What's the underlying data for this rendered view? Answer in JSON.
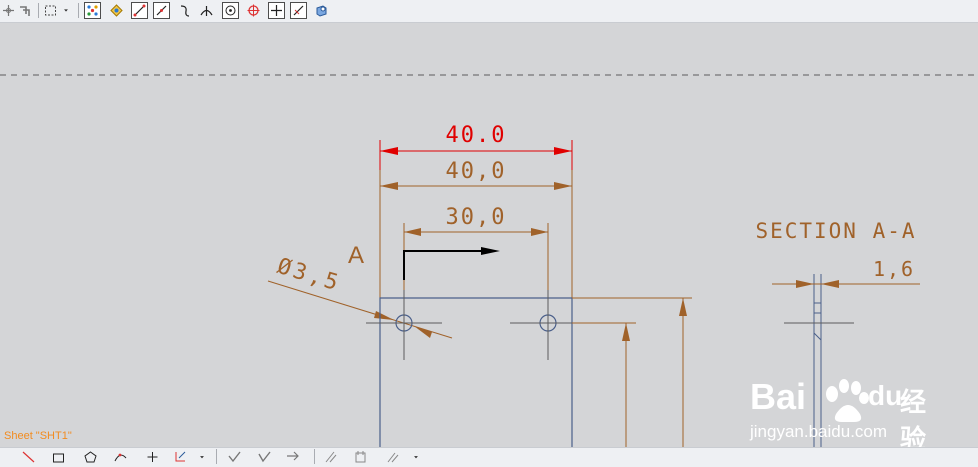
{
  "sheet": {
    "label": "Sheet \"SHT1\""
  },
  "drawing": {
    "dim_overall_red": "40.0",
    "dim_overall": "40,0",
    "dim_hole_spacing": "30,0",
    "section_letter": "A",
    "hole_diameter": "Ø3,5",
    "section_title": "SECTION A-A",
    "section_thickness": "1,6"
  },
  "watermark": {
    "brand": "Bai",
    "brand2": "du",
    "cn": "经验",
    "url": "jingyan.baidu.com"
  },
  "colors": {
    "background": "#d4d5d7",
    "dimension": "#a0622a",
    "dimension_active": "#e00000",
    "geometry": "#4a5f8a",
    "centerline": "#5c5c5c",
    "sheet_label": "#f28b1f"
  },
  "toolbar_top": [
    "move-icon",
    "pick-icon",
    "select-rectangle-icon",
    "snap-points-icon",
    "snap-intersection-icon",
    "line-icon",
    "angled-line-icon",
    "curve-icon",
    "perpendicular-icon",
    "center-icon",
    "circle-snap-icon",
    "crosshair-icon",
    "diagonal-icon",
    "view-icon"
  ],
  "toolbar_bottom": [
    "line-tool-icon",
    "rectangle-tool-icon",
    "polygon-tool-icon",
    "spline-tool-icon",
    "point-tool-icon",
    "transform-tool-icon",
    "check-icon",
    "trim-icon",
    "extend-icon",
    "hatch-icon",
    "insert-icon",
    "fillet-icon"
  ]
}
